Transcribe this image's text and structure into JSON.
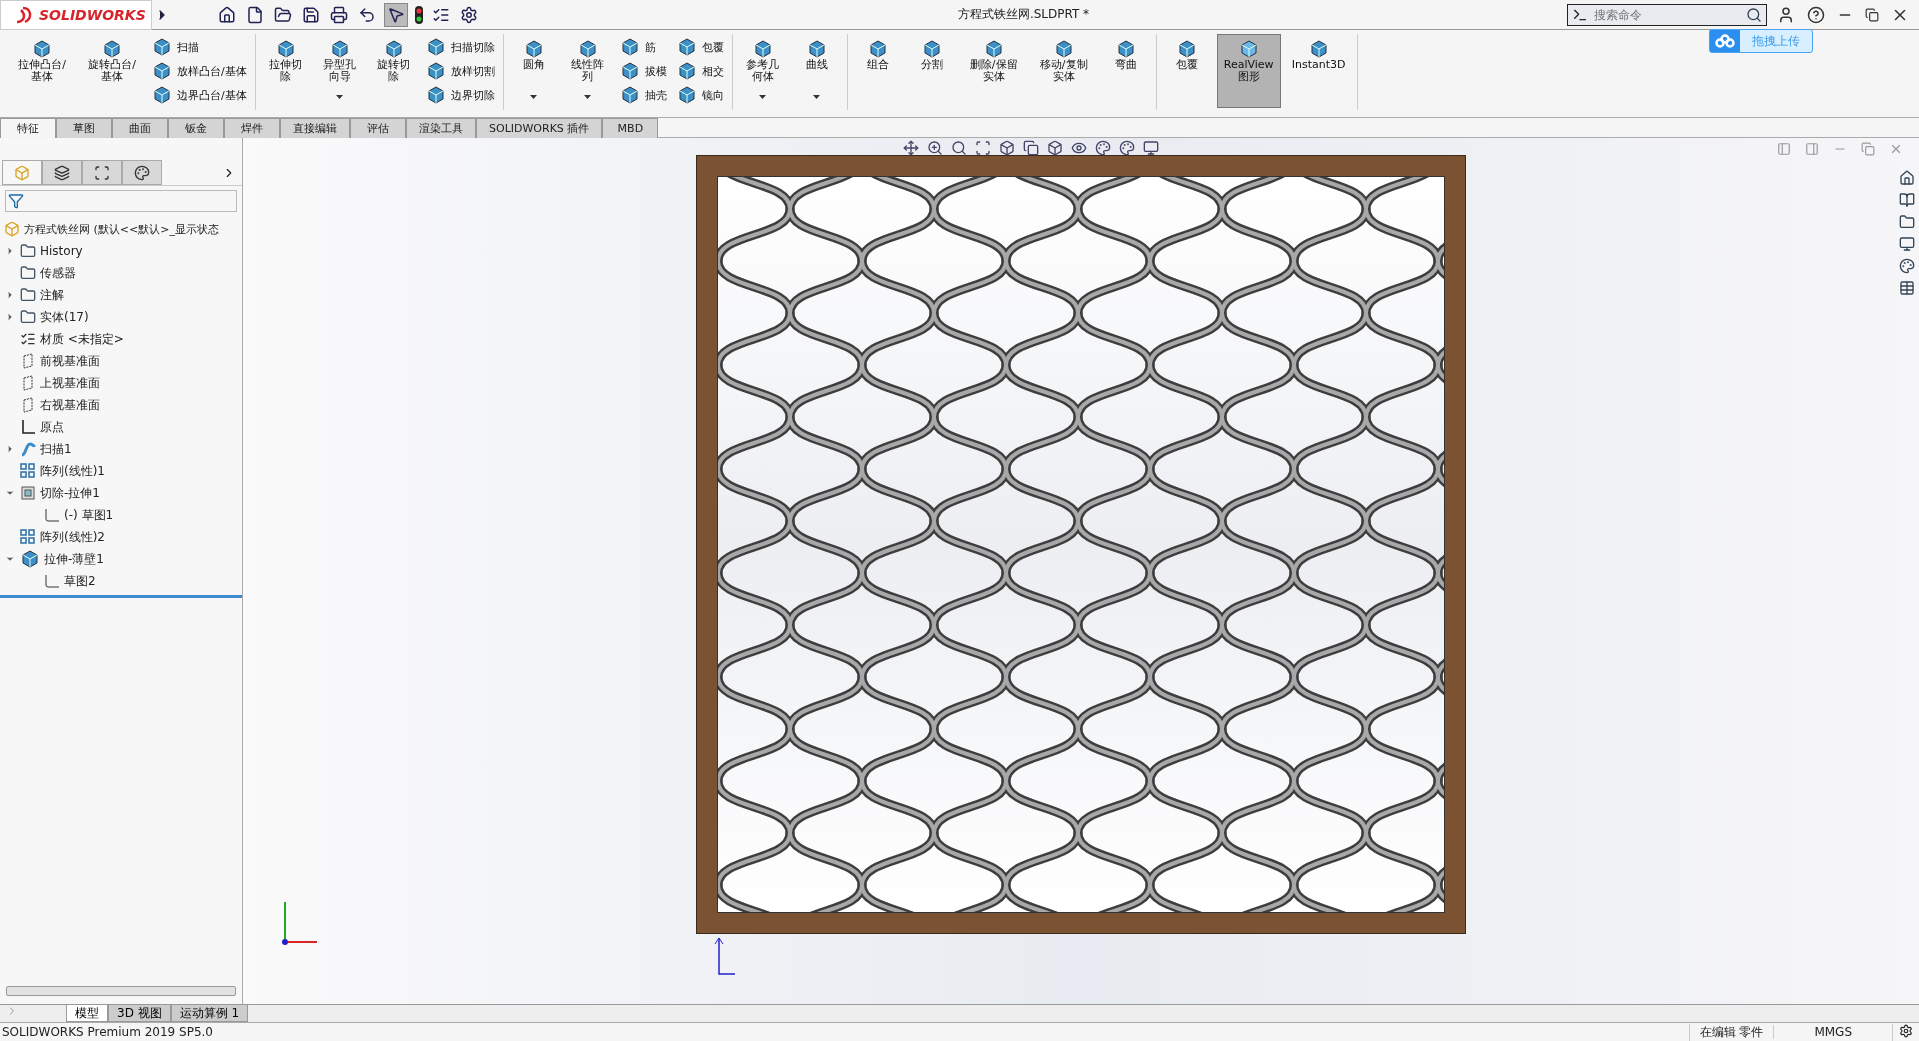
{
  "app": {
    "logo": "SOLIDWORKS"
  },
  "window": {
    "title": "方程式铁丝网.SLDPRT *"
  },
  "search": {
    "placeholder": "搜索命令"
  },
  "upload_button": {
    "label": "拖拽上传"
  },
  "ribbon": {
    "groups": [
      {
        "items": [
          {
            "kind": "large",
            "label": "拉伸凸台/基体",
            "dropdown": false,
            "selected": false
          },
          {
            "kind": "large",
            "label": "旋转凸台/基体",
            "dropdown": false,
            "selected": false
          },
          {
            "kind": "stack",
            "labels": [
              "扫描",
              "放样凸台/基体",
              "边界凸台/基体"
            ]
          }
        ]
      },
      {
        "items": [
          {
            "kind": "large",
            "label": "拉伸切除",
            "dropdown": false,
            "selected": false
          },
          {
            "kind": "large",
            "label": "异型孔向导",
            "dropdown": true,
            "selected": false
          },
          {
            "kind": "large",
            "label": "旋转切除",
            "dropdown": false,
            "selected": false
          },
          {
            "kind": "stack",
            "labels": [
              "扫描切除",
              "放样切割",
              "边界切除"
            ]
          }
        ]
      },
      {
        "items": [
          {
            "kind": "large",
            "label": "圆角",
            "dropdown": true,
            "selected": false
          },
          {
            "kind": "large",
            "label": "线性阵列",
            "dropdown": true,
            "selected": false
          },
          {
            "kind": "stack",
            "labels": [
              "筋",
              "拔模",
              "抽壳"
            ]
          },
          {
            "kind": "stack",
            "labels": [
              "包覆",
              "相交",
              "镜向"
            ]
          }
        ]
      },
      {
        "items": [
          {
            "kind": "large",
            "label": "参考几何体",
            "dropdown": true,
            "selected": false
          },
          {
            "kind": "large",
            "label": "曲线",
            "dropdown": true,
            "selected": false
          }
        ]
      },
      {
        "items": [
          {
            "kind": "large",
            "label": "组合",
            "dropdown": false,
            "selected": false
          },
          {
            "kind": "large",
            "label": "分割",
            "dropdown": false,
            "selected": false
          },
          {
            "kind": "large",
            "label": "删除/保留实体",
            "dropdown": false,
            "selected": false
          },
          {
            "kind": "large",
            "label": "移动/复制实体",
            "dropdown": false,
            "selected": false
          },
          {
            "kind": "large",
            "label": "弯曲",
            "dropdown": false,
            "selected": false
          }
        ]
      },
      {
        "items": [
          {
            "kind": "large",
            "label": "包覆",
            "dropdown": false,
            "selected": false
          },
          {
            "kind": "large",
            "label": "RealView图形",
            "dropdown": false,
            "selected": true
          },
          {
            "kind": "large",
            "label": "Instant3D",
            "dropdown": false,
            "selected": false
          }
        ]
      }
    ]
  },
  "command_tabs": [
    {
      "label": "特征",
      "selected": true
    },
    {
      "label": "草图",
      "selected": false
    },
    {
      "label": "曲面",
      "selected": false
    },
    {
      "label": "钣金",
      "selected": false
    },
    {
      "label": "焊件",
      "selected": false
    },
    {
      "label": "直接编辑",
      "selected": false
    },
    {
      "label": "评估",
      "selected": false
    },
    {
      "label": "渲染工具",
      "selected": false
    },
    {
      "label": "SOLIDWORKS 插件",
      "selected": false
    },
    {
      "label": "MBD",
      "selected": false
    }
  ],
  "panel_tabs": [
    {
      "selected": true
    },
    {
      "selected": false
    },
    {
      "selected": false
    },
    {
      "selected": false
    }
  ],
  "feature_tree": {
    "root": "方程式铁丝网  (默认<<默认>_显示状态",
    "items": [
      {
        "kind": "folder",
        "label": "History",
        "expanded": false
      },
      {
        "kind": "folder",
        "label": "传感器"
      },
      {
        "kind": "folder",
        "label": "注解",
        "expanded": false
      },
      {
        "kind": "folder",
        "label": "实体(17)",
        "expanded": false
      },
      {
        "kind": "material",
        "label": "材质 <未指定>"
      },
      {
        "kind": "plane",
        "label": "前视基准面"
      },
      {
        "kind": "plane",
        "label": "上视基准面"
      },
      {
        "kind": "plane",
        "label": "右视基准面"
      },
      {
        "kind": "origin",
        "label": "原点"
      },
      {
        "kind": "sweep",
        "label": "扫描1",
        "expanded": false
      },
      {
        "kind": "pattern",
        "label": "阵列(线性)1"
      },
      {
        "kind": "cut",
        "label": "切除-拉伸1",
        "expanded": true,
        "children": [
          {
            "kind": "sketch",
            "label": "(-) 草图1"
          }
        ]
      },
      {
        "kind": "pattern",
        "label": "阵列(线性)2"
      },
      {
        "kind": "extrude",
        "label": "拉伸-薄壁1",
        "expanded": true,
        "children": [
          {
            "kind": "sketch",
            "label": "草图2"
          }
        ]
      }
    ]
  },
  "bottom_tabs": [
    {
      "label": "模型",
      "selected": true
    },
    {
      "label": "3D 视图",
      "selected": false
    },
    {
      "label": "运动算例 1",
      "selected": false
    }
  ],
  "status_bar": {
    "product": "SOLIDWORKS Premium 2019 SP5.0",
    "mode": "在编辑 零件",
    "units": "MMGS"
  }
}
